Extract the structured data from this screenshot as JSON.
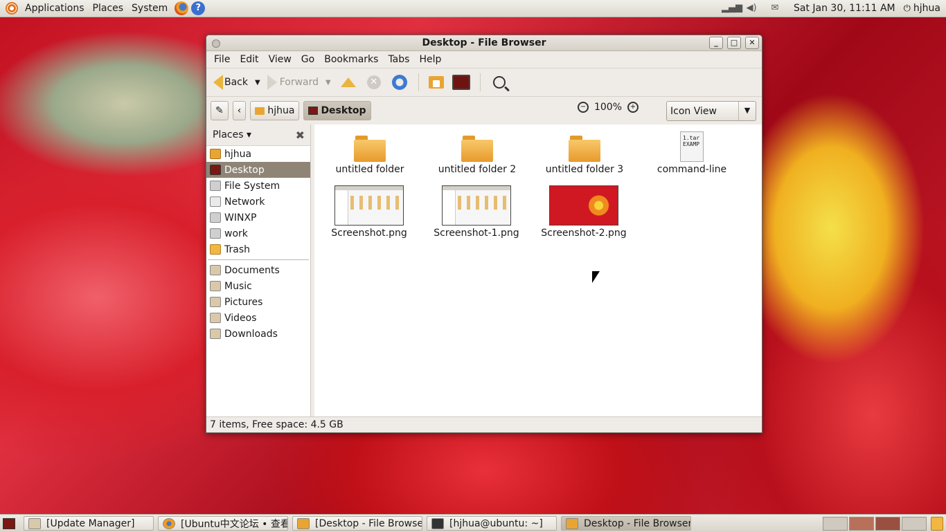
{
  "top_panel": {
    "menus": [
      "Applications",
      "Places",
      "System"
    ],
    "clock": "Sat Jan 30, 11:11 AM",
    "user": "hjhua"
  },
  "window": {
    "title": "Desktop - File Browser",
    "menubar": [
      "File",
      "Edit",
      "View",
      "Go",
      "Bookmarks",
      "Tabs",
      "Help"
    ],
    "toolbar": {
      "back_label": "Back",
      "forward_label": "Forward"
    },
    "location": {
      "crumbs": [
        "hjhua",
        "Desktop"
      ],
      "zoom_level": "100%",
      "view_mode": "Icon View"
    },
    "sidebar": {
      "header": "Places",
      "places": [
        "hjhua",
        "Desktop",
        "File System",
        "Network",
        "WINXP",
        "work",
        "Trash"
      ],
      "bookmarks": [
        "Documents",
        "Music",
        "Pictures",
        "Videos",
        "Downloads"
      ],
      "selected": "Desktop"
    },
    "items": [
      {
        "name": "untitled folder",
        "type": "folder"
      },
      {
        "name": "untitled folder 2",
        "type": "folder"
      },
      {
        "name": "untitled folder 3",
        "type": "folder"
      },
      {
        "name": "command-line",
        "type": "text",
        "preview": "1.tar\nEXAMP"
      },
      {
        "name": "Screenshot.png",
        "type": "image"
      },
      {
        "name": "Screenshot-1.png",
        "type": "image"
      },
      {
        "name": "Screenshot-2.png",
        "type": "image"
      }
    ],
    "status": "7 items, Free space: 4.5 GB"
  },
  "taskbar": {
    "tasks": [
      {
        "label": "[Update Manager]",
        "icon": "update-icon",
        "active": false
      },
      {
        "label": "[Ubuntu中文论坛 • 查看…",
        "icon": "firefox-icon",
        "active": false
      },
      {
        "label": "[Desktop - File Browser]",
        "icon": "folder-icon",
        "active": false
      },
      {
        "label": "[hjhua@ubuntu: ~]",
        "icon": "terminal-icon",
        "active": false
      },
      {
        "label": "Desktop - File Browser",
        "icon": "folder-icon",
        "active": true
      }
    ]
  }
}
